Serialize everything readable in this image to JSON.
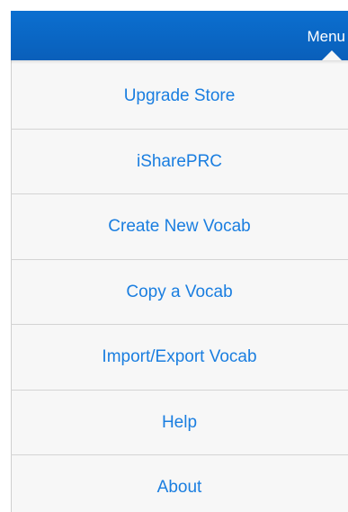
{
  "colors": {
    "navbar": "#0a66c4",
    "menu_text": "#1a7ee0",
    "popover_bg": "#f7f7f7",
    "separator": "#d4d4d4"
  },
  "navbar": {
    "menu_label": "Menu"
  },
  "menu": {
    "items": [
      {
        "label": "Upgrade Store"
      },
      {
        "label": "iSharePRC"
      },
      {
        "label": "Create New Vocab"
      },
      {
        "label": "Copy a Vocab"
      },
      {
        "label": "Import/Export Vocab"
      },
      {
        "label": "Help"
      },
      {
        "label": "About"
      }
    ]
  }
}
